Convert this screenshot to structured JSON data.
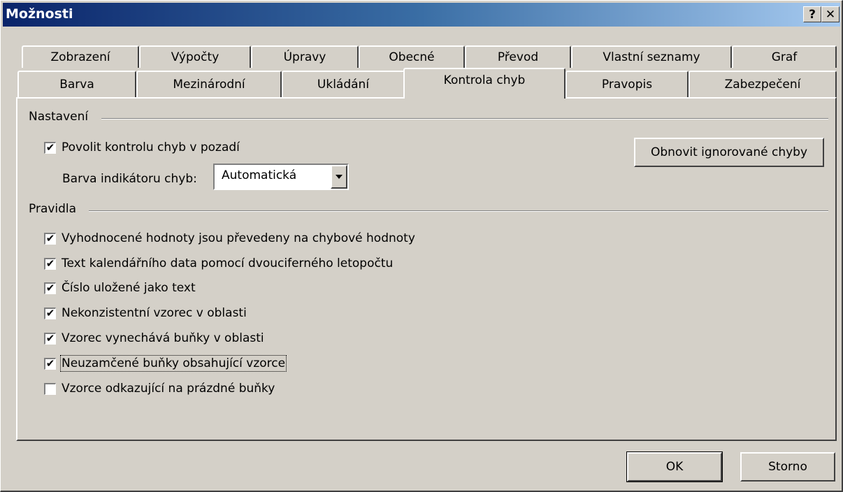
{
  "window": {
    "title": "Možnosti",
    "help_button": "?",
    "close_button": "✕"
  },
  "tabs": {
    "row1": [
      "Zobrazení",
      "Výpočty",
      "Úpravy",
      "Obecné",
      "Převod",
      "Vlastní seznamy",
      "Graf"
    ],
    "row2": [
      "Barva",
      "Mezinárodní",
      "Ukládání",
      "Kontrola chyb",
      "Pravopis",
      "Zabezpečení"
    ],
    "active": "Kontrola chyb"
  },
  "settings": {
    "group_label": "Nastavení",
    "background_check": {
      "label": "Povolit kontrolu chyb v pozadí",
      "checked": true
    },
    "color_label": "Barva indikátoru chyb:",
    "color_value": "Automatická",
    "reset_button": "Obnovit ignorované chyby"
  },
  "rules": {
    "group_label": "Pravidla",
    "items": [
      {
        "label": "Vyhodnocené hodnoty jsou převedeny na chybové hodnoty",
        "checked": true
      },
      {
        "label": "Text kalendářního data pomocí dvouciferného letopočtu",
        "checked": true
      },
      {
        "label": "Číslo uložené jako text",
        "checked": true
      },
      {
        "label": "Nekonzistentní vzorec v oblasti",
        "checked": true
      },
      {
        "label": "Vzorec vynechává buňky v oblasti",
        "checked": true
      },
      {
        "label": "Neuzamčené buňky obsahující vzorce",
        "checked": true
      },
      {
        "label": "Vzorce odkazující na prázdné buňky",
        "checked": false
      }
    ]
  },
  "footer": {
    "ok": "OK",
    "cancel": "Storno"
  },
  "check_mark": "✔"
}
